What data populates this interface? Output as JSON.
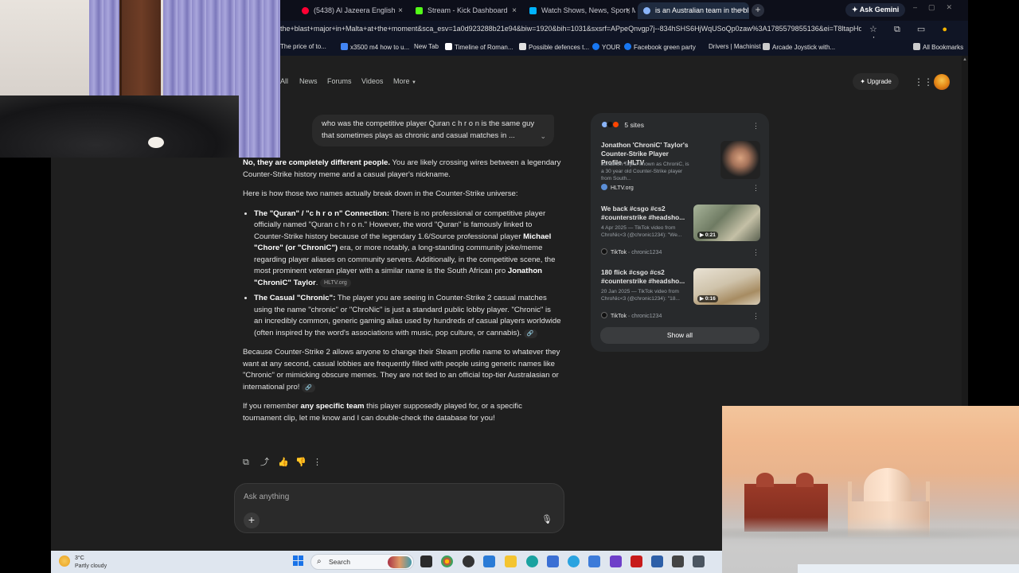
{
  "browser": {
    "tabs": [
      {
        "label": "(5438) Al Jazeera English",
        "color": "#ff0033"
      },
      {
        "label": "Stream - Kick Dashboard",
        "color": "#53fc18"
      },
      {
        "label": "Watch Shows, News, Sport, Mo",
        "color": "#00b3ff"
      },
      {
        "label": "is an Australian team in the bla",
        "color": "#8ab4f8"
      }
    ],
    "new_tab": "+",
    "ask_gemini": "Ask Gemini",
    "url": "the+blast+major+in+Malta+at+the+moment&sca_esv=1a0d923288b21e94&biw=1920&bih=1031&sxsrf=APpeQnvgp7j--834hSHS6HjWqUSoQp0zaw%3A1785579855136&ei=T8ltapHqB_mzvr0Pr...",
    "bookmarks": [
      {
        "label": "The price of to...",
        "color": "#f3b23a"
      },
      {
        "label": "x3500 m4 how to u...",
        "color": "#4285f4"
      },
      {
        "label": "New Tab",
        "color": "#e0e0e0"
      },
      {
        "label": "Timeline of Roman...",
        "color": "#ffffff"
      },
      {
        "label": "Possible defences t...",
        "color": "#e0e0e0"
      },
      {
        "label": "YOUR",
        "color": "#1877f2"
      },
      {
        "label": "Facebook green party",
        "color": "#1877f2"
      },
      {
        "label": "Drivers | Machinist",
        "color": "#e0e0e0"
      },
      {
        "label": "Arcade Joystick with...",
        "color": "#cccccc"
      },
      {
        "label": "All Bookmarks",
        "color": "#cccccc"
      }
    ]
  },
  "nav": {
    "links": [
      "All",
      "News",
      "Forums",
      "Videos",
      "More"
    ],
    "upgrade": "Upgrade"
  },
  "user_message": "who was the competitive player Quran c h r o n is the same guy that sometimes plays as chronic and casual matches in ...",
  "response": {
    "intro_bold": "No, they are completely different people.",
    "intro_rest": " You are likely crossing wires between a legendary Counter-Strike history meme and a casual player's nickname.",
    "lead": "Here is how those two names actually break down in the Counter-Strike universe:",
    "b1_title": "The \"Quran\" / \"c h r o n\" Connection:",
    "b1_text1": " There is no professional or competitive player officially named \"Quran c h r o n.\" However, the word \"Quran\" is famously linked to Counter-Strike history because of the legendary 1.6/Source professional player ",
    "b1_name1": "Michael \"Chore\" (or \"ChroniC\")",
    "b1_text2": " era, or more notably, a long-standing community joke/meme regarding player aliases on community servers. Additionally, in the competitive scene, the most prominent veteran player with a similar name is the South African pro ",
    "b1_name2": "Jonathon \"ChroniC\" Taylor",
    "b1_cite": "HLTV.org",
    "b2_title": "The Casual \"Chronic\":",
    "b2_text": " The player you are seeing in Counter-Strike 2 casual matches using the name \"chronic\" or \"ChroNic\" is just a standard public lobby player. \"Chronic\" is an incredibly common, generic gaming alias used by hundreds of casual players worldwide (often inspired by the word's associations with music, pop culture, or cannabis).",
    "para2": "Because Counter-Strike 2 allows anyone to change their Steam profile name to whatever they want at any second, casual lobbies are frequently filled with people using generic names like \"Chronic\" or mimicking obscure memes. They are not tied to an official top-tier Australasian or international pro!",
    "para3_a": "If you remember ",
    "para3_bold": "any specific team",
    "para3_b": " this player supposedly played for, or a specific tournament clip, let me know and I can double-check the database for you!"
  },
  "input": {
    "placeholder": "Ask anything"
  },
  "sources": {
    "count_label": "5 sites",
    "items": [
      {
        "title": "Jonathon 'ChroniC' Taylor's Counter-Strike Player Profile - HLTV",
        "desc": "Jonathon Taylor known as ChroniC, is a 30 year old Counter-Strike player from South...",
        "site": "HLTV.org",
        "handle": "",
        "duration": ""
      },
      {
        "title": "We back #csgo #cs2 #counterstrike #headsho...",
        "desc": "4 Apr 2025 — TikTok video from ChroNic<3 (@chronic1234): \"We...",
        "site": "TikTok",
        "handle": "chronic1234",
        "duration": "0:21"
      },
      {
        "title": "180 flick #csgo #cs2 #counterstrike #headsho...",
        "desc": "20 Jan 2025 — TikTok video from ChroNic<3 (@chronic1234): \"18...",
        "site": "TikTok",
        "handle": "chronic1234",
        "duration": "0:16"
      }
    ],
    "show_all": "Show all"
  },
  "taskbar": {
    "temp": "3°C",
    "condition": "Partly cloudy",
    "search": "Search"
  }
}
